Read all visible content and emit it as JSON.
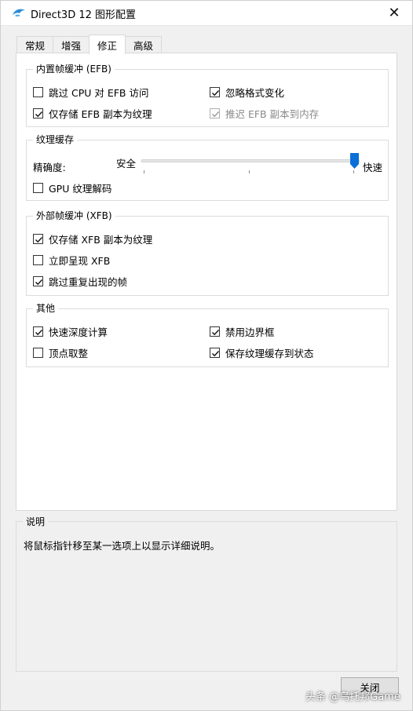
{
  "window": {
    "title": "Direct3D 12 图形配置",
    "close_glyph": "✕",
    "icon": "dolphin-icon"
  },
  "tabs": [
    {
      "label": "常规",
      "active": false
    },
    {
      "label": "增强",
      "active": false
    },
    {
      "label": "修正",
      "active": true
    },
    {
      "label": "高级",
      "active": false
    }
  ],
  "efb": {
    "title": "内置帧缓冲 (EFB)",
    "options": [
      {
        "label": "跳过 CPU 对 EFB 访问",
        "checked": false,
        "disabled": false
      },
      {
        "label": "忽略格式变化",
        "checked": true,
        "disabled": false
      },
      {
        "label": "仅存储 EFB 副本为纹理",
        "checked": true,
        "disabled": false
      },
      {
        "label": "推迟 EFB 副本到内存",
        "checked": true,
        "disabled": true
      }
    ]
  },
  "texture_cache": {
    "title": "纹理缓存",
    "accuracy_label": "精确度:",
    "left_label": "安全",
    "right_label": "快速",
    "slider_value": 1.0,
    "gpu_decode": {
      "label": "GPU 纹理解码",
      "checked": false
    }
  },
  "xfb": {
    "title": "外部帧缓冲 (XFB)",
    "options": [
      {
        "label": "仅存储 XFB 副本为纹理",
        "checked": true
      },
      {
        "label": "立即呈现 XFB",
        "checked": false
      },
      {
        "label": "跳过重复出现的帧",
        "checked": true
      }
    ]
  },
  "other": {
    "title": "其他",
    "options": [
      {
        "label": "快速深度计算",
        "checked": true
      },
      {
        "label": "禁用边界框",
        "checked": true
      },
      {
        "label": "顶点取整",
        "checked": false
      },
      {
        "label": "保存纹理缓存到状态",
        "checked": true
      }
    ]
  },
  "description": {
    "title": "说明",
    "text": "将鼠标指针移至某一选项上以显示详细说明。"
  },
  "buttons": {
    "close": "关闭"
  },
  "watermark": "头条 @乌托邦Game",
  "colors": {
    "accent": "#0078d7",
    "slider_thumb": "#0a6fd6"
  }
}
